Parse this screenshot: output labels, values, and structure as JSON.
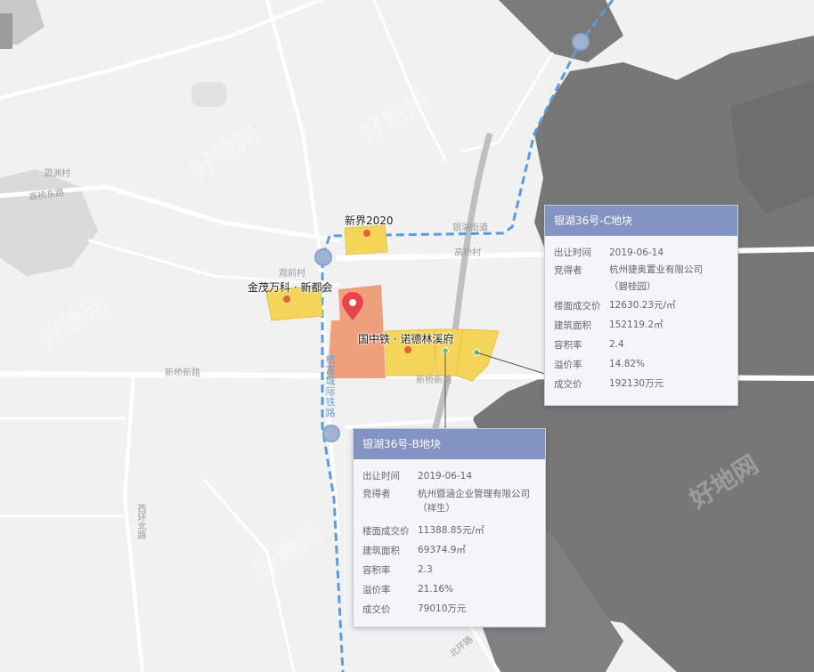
{
  "map": {
    "road_labels": {
      "sizhou_village": "泗洲村",
      "gaoqiao_east_rd": "高桥东路",
      "guanqian_village": "观前村",
      "yinhu_street": "银湖街道",
      "gaoqiao_village": "高桥村",
      "xinqiao_new_rd": "新桥新路",
      "xinqiao_new_rd_2": "新桥新路",
      "hangfu_railway": "杭富城际铁路",
      "xihuan_north_rd": "西环北路",
      "beihuan_rd": "北环路"
    },
    "pois": {
      "xinjie2020": "新界2020",
      "jinmao_vanke": "金茂万科 · 新都会",
      "crcc_norder": "国中铁 · 诺德林溪府"
    },
    "watermark_text": "好地网",
    "colors": {
      "land_yellow": "#f4d55a",
      "land_orange": "#eea07c",
      "poi_dot": "#e0613f",
      "plot_dot": "#7cc36a",
      "marker_red": "#e8434a",
      "metro_line": "#5b9be0",
      "popup_header": "#8293c4",
      "hills": "#777777",
      "road": "#ffffff"
    }
  },
  "popup_c": {
    "title": "银湖36号-C地块",
    "rows": [
      {
        "k": "出让时间",
        "v": "2019-06-14"
      },
      {
        "k": "竞得者",
        "v": "杭州捷奥置业有限公司"
      },
      {
        "k": "",
        "v": "（碧桂园）"
      },
      {
        "k": "楼面成交价",
        "v": "12630.23元/㎡"
      },
      {
        "k": "建筑面积",
        "v": "152119.2㎡"
      },
      {
        "k": "容积率",
        "v": "2.4"
      },
      {
        "k": "溢价率",
        "v": "14.82%"
      },
      {
        "k": "成交价",
        "v": "192130万元"
      }
    ]
  },
  "popup_b": {
    "title": "银湖36号-B地块",
    "rows": [
      {
        "k": "出让时间",
        "v": "2019-06-14"
      },
      {
        "k": "竞得者",
        "v": "杭州暨涵企业管理有限公司（祥生）"
      },
      {
        "k": "楼面成交价",
        "v": "11388.85元/㎡"
      },
      {
        "k": "建筑面积",
        "v": "69374.9㎡"
      },
      {
        "k": "容积率",
        "v": "2.3"
      },
      {
        "k": "溢价率",
        "v": "21.16%"
      },
      {
        "k": "成交价",
        "v": "79010万元"
      }
    ]
  }
}
